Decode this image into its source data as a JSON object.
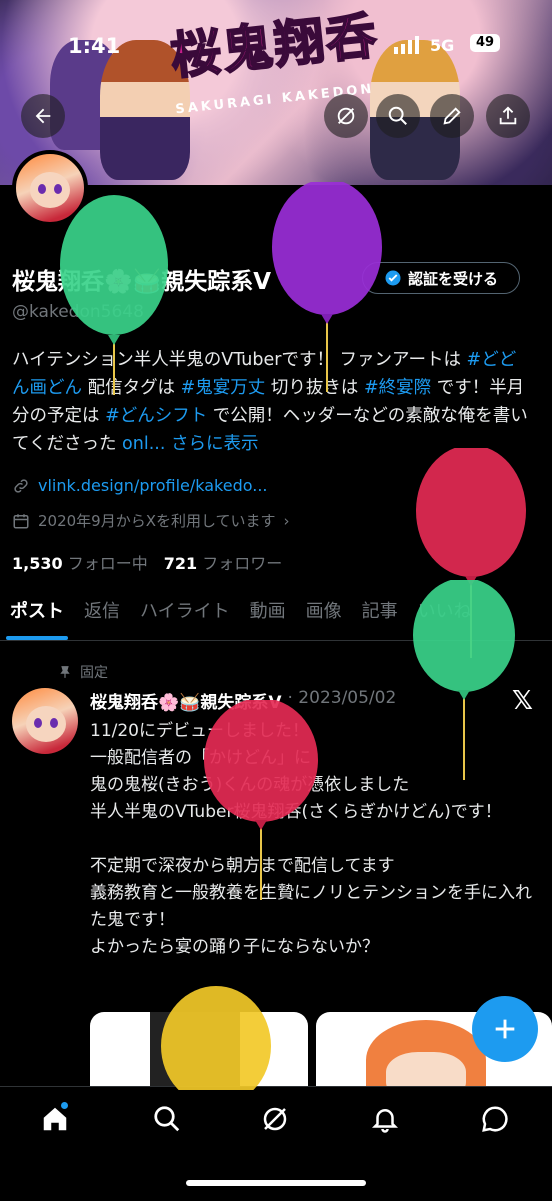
{
  "status_bar": {
    "time": "1:41",
    "network": "5G",
    "battery": "49"
  },
  "banner": {
    "title": "桜鬼翔呑",
    "subtitle": "SAKURAGI KAKEDON"
  },
  "profile": {
    "name": "桜鬼翔呑🌸🥁親失踪系V",
    "handle": "@kakedon5648",
    "verify_button": "認証を受ける",
    "bio_parts": [
      {
        "text": "ハイテンション半人半鬼のVTuberです！ ファンアートは ",
        "link": false
      },
      {
        "text": "#どどん画どん",
        "link": true
      },
      {
        "text": " 配信タグは ",
        "link": false
      },
      {
        "text": "#鬼宴万丈",
        "link": true
      },
      {
        "text": " 切り抜きは ",
        "link": false
      },
      {
        "text": "#終宴際",
        "link": true
      },
      {
        "text": " です！半月分の予定は ",
        "link": false
      },
      {
        "text": "#どんシフト",
        "link": true
      },
      {
        "text": " で公開！ヘッダーなどの素敵な俺を書いてくださった ",
        "link": false
      },
      {
        "text": "onl...",
        "link": true
      },
      {
        "text": "  ",
        "link": false
      },
      {
        "text": "さらに表示",
        "link": true
      }
    ],
    "url": "vlink.design/profile/kakedo...",
    "joined": "2020年9月からXを利用しています",
    "following_count": "1,530",
    "following_label": "フォロー中",
    "followers_count": "721",
    "followers_label": "フォロワー"
  },
  "tabs": [
    "ポスト",
    "返信",
    "ハイライト",
    "動画",
    "画像",
    "記事",
    "いいね"
  ],
  "post": {
    "pinned_label": "固定",
    "author": "桜鬼翔呑🌸🥁親失踪系V",
    "date": "· 2023/05/02",
    "text": "11/20にデビューしました！\n一般配信者の「かけどん」に\n鬼の鬼桜(きおう)くんの魂が憑依しました\n半人半鬼のVTuber桜鬼翔呑(さくらぎかけどん)です！\n\n不定期で深夜から朝方まで配信してます\n義務教育と一般教養を生贄にノリとテンションを手に入れた鬼です！\nよかったら宴の踊り子にならないか？"
  },
  "icons": {
    "back": "back-arrow-icon",
    "search": "search-icon",
    "edit": "pencil-icon",
    "share": "share-icon",
    "grok": "grok-icon",
    "home": "home-icon",
    "notifications": "bell-icon",
    "messages": "message-icon",
    "compose": "plus-icon",
    "verified": "verified-badge-icon",
    "link": "link-icon",
    "calendar": "calendar-icon",
    "pin": "pin-icon",
    "x": "x-logo-icon"
  },
  "colors": {
    "accent": "#1d9bf0",
    "background": "#000000",
    "muted": "#71767b"
  },
  "balloons": [
    {
      "color": "green"
    },
    {
      "color": "purple"
    },
    {
      "color": "red"
    },
    {
      "color": "green"
    },
    {
      "color": "red"
    },
    {
      "color": "yellow"
    }
  ]
}
